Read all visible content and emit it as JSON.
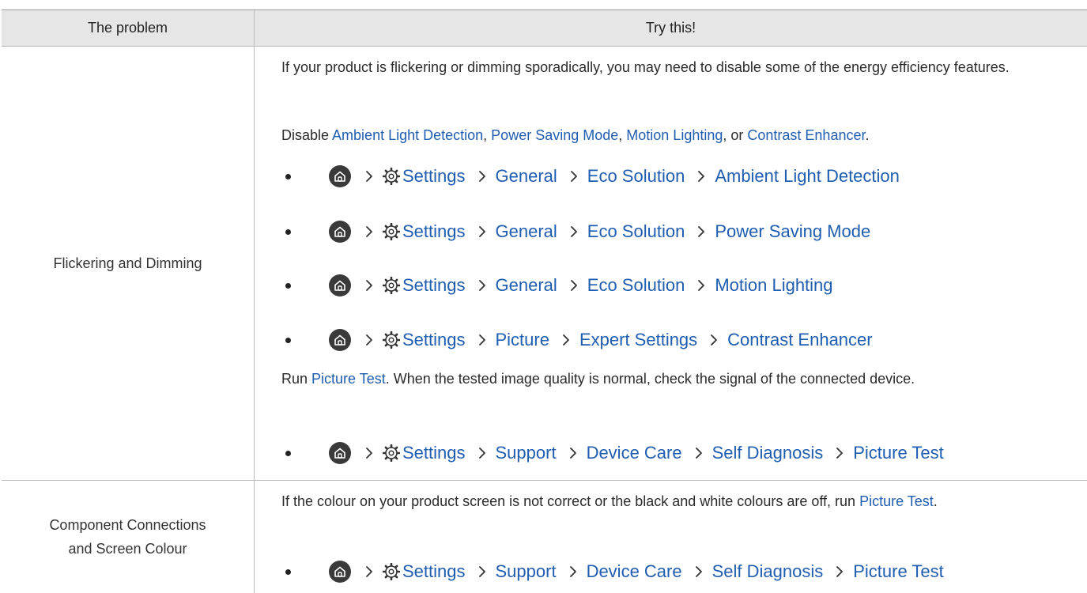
{
  "colors": {
    "link": "#1f5db0",
    "header_bg": "#e6e6e6",
    "text": "#2b2b2b",
    "home_icon_bg": "#3a3a3a"
  },
  "header": {
    "col1": "The problem",
    "col2": "Try this!"
  },
  "rows": [
    {
      "problem": "Flickering and Dimming",
      "intro": "If your product is flickering or dimming sporadically, you may need to disable some of the energy efficiency features.",
      "disable_line": {
        "prefix": "Disable ",
        "items": [
          "Ambient Light Detection",
          "Power Saving Mode",
          "Motion Lighting",
          "Contrast Enhancer"
        ],
        "sep1": ", ",
        "sep2": ", ",
        "sep3": ", or ",
        "suffix": "."
      },
      "paths": [
        [
          "Settings",
          "General",
          "Eco Solution",
          "Ambient Light Detection"
        ],
        [
          "Settings",
          "General",
          "Eco Solution",
          "Power Saving Mode"
        ],
        [
          "Settings",
          "General",
          "Eco Solution",
          "Motion Lighting"
        ],
        [
          "Settings",
          "Picture",
          "Expert Settings",
          "Contrast Enhancer"
        ]
      ],
      "run_line": {
        "prefix": "Run ",
        "link": "Picture Test",
        "suffix": ". When the tested image quality is normal, check the signal of the connected device."
      },
      "final_path": [
        "Settings",
        "Support",
        "Device Care",
        "Self Diagnosis",
        "Picture Test"
      ]
    },
    {
      "problem_line1": "Component Connections",
      "problem_line2": "and Screen Colour",
      "intro": "If the colour on your product screen is not correct or the black and white colours are off, run",
      "link": "Picture Test",
      "suffix": ".",
      "path": [
        "Settings",
        "Support",
        "Device Care",
        "Self Diagnosis",
        "Picture Test"
      ]
    }
  ]
}
